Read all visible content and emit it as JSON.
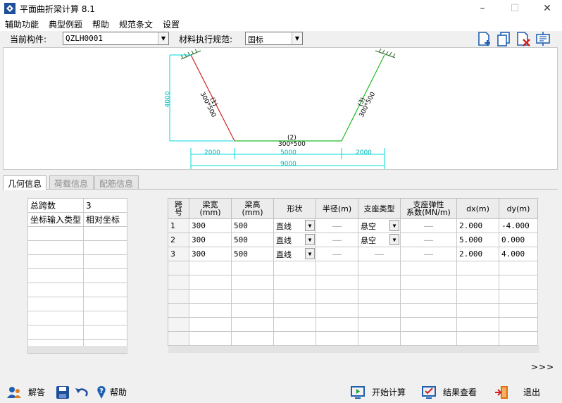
{
  "window": {
    "title": "平面曲折梁计算 8.1",
    "minimize": "–",
    "maximize": "☐",
    "close": "✕"
  },
  "menu": [
    "辅助功能",
    "典型例题",
    "帮助",
    "规范条文",
    "设置"
  ],
  "toolbar": {
    "component_label": "当前构件:",
    "component_value": "QZLH0001",
    "material_label": "材料执行规范:",
    "material_value": "国标",
    "icons": [
      "add-icon",
      "copy-icon",
      "delete-icon",
      "export-icon"
    ]
  },
  "drawing": {
    "height_dim": "4000",
    "dims": [
      "2000",
      "5000",
      "2000"
    ],
    "total_dim": "9000",
    "segments": [
      {
        "num": "(1)",
        "size": "300*500"
      },
      {
        "num": "(2)",
        "size": "300*500"
      },
      {
        "num": "(3)",
        "size": "300*500"
      }
    ],
    "colors": {
      "seg1": "#cc2222",
      "seg2": "#22bb22",
      "dim": "#00d8d8"
    }
  },
  "tabs": [
    "几何信息",
    "荷载信息",
    "配筋信息"
  ],
  "left_grid": {
    "rows": [
      [
        "总跨数",
        "3"
      ],
      [
        "坐标输入类型",
        "相对坐标"
      ]
    ],
    "empty_rows": 9
  },
  "main_grid": {
    "headers": [
      "跨号",
      "梁宽\n(mm)",
      "梁高\n(mm)",
      "形状",
      "半径(m)",
      "支座类型",
      "支座弹性\n系数(MN/m)",
      "dx(m)",
      "dy(m)"
    ],
    "rows": [
      [
        "1",
        "300",
        "500",
        "直线",
        "——",
        "悬空",
        "——",
        "2.000",
        "-4.000"
      ],
      [
        "2",
        "300",
        "500",
        "直线",
        "——",
        "悬空",
        "——",
        "5.000",
        "0.000"
      ],
      [
        "3",
        "300",
        "500",
        "直线",
        "——",
        "——",
        "——",
        "2.000",
        "4.000"
      ]
    ],
    "empty_rows": 6
  },
  "more": ">>>",
  "footer": {
    "solve": "解答",
    "help": "帮助",
    "start": "开始计算",
    "results": "结果查看",
    "exit": "退出"
  }
}
